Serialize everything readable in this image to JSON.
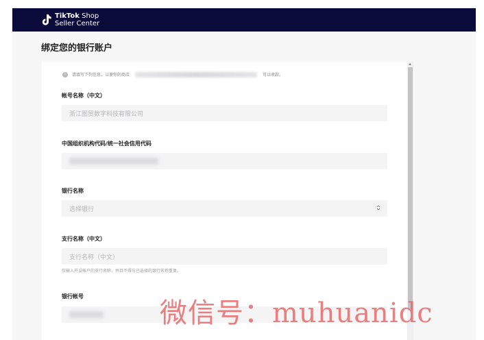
{
  "header": {
    "brand_line1_bold": "TikTok",
    "brand_line1_rest": " Shop",
    "brand_line2": "Seller Center",
    "background_color": "#0b0b3b"
  },
  "page": {
    "title": "绑定您的银行账户"
  },
  "notice": {
    "prefix": "请填写下列信息，以便你的商店",
    "suffix": "可以收款。"
  },
  "form": {
    "account_name": {
      "label": "帐号名称（中文）",
      "value": "浙江图贸数字科技有限公司"
    },
    "org_code": {
      "label": "中国组织机构代码/统一社会信用代码"
    },
    "bank_name": {
      "label": "银行名称",
      "placeholder": "选择银行"
    },
    "branch_name": {
      "label": "支行名称（中文）",
      "placeholder": "支行名称（中文）",
      "hint": "仅输入开设帐户的支行名称，并且不得与已选择的银行名称重复。"
    },
    "account_number": {
      "label": "银行帐号"
    }
  },
  "watermark": {
    "text": "微信号：muhuanidc"
  },
  "icons": {
    "logo": "tiktok-note-icon",
    "notice": "info-icon",
    "select": "chevron-updown-icon"
  }
}
